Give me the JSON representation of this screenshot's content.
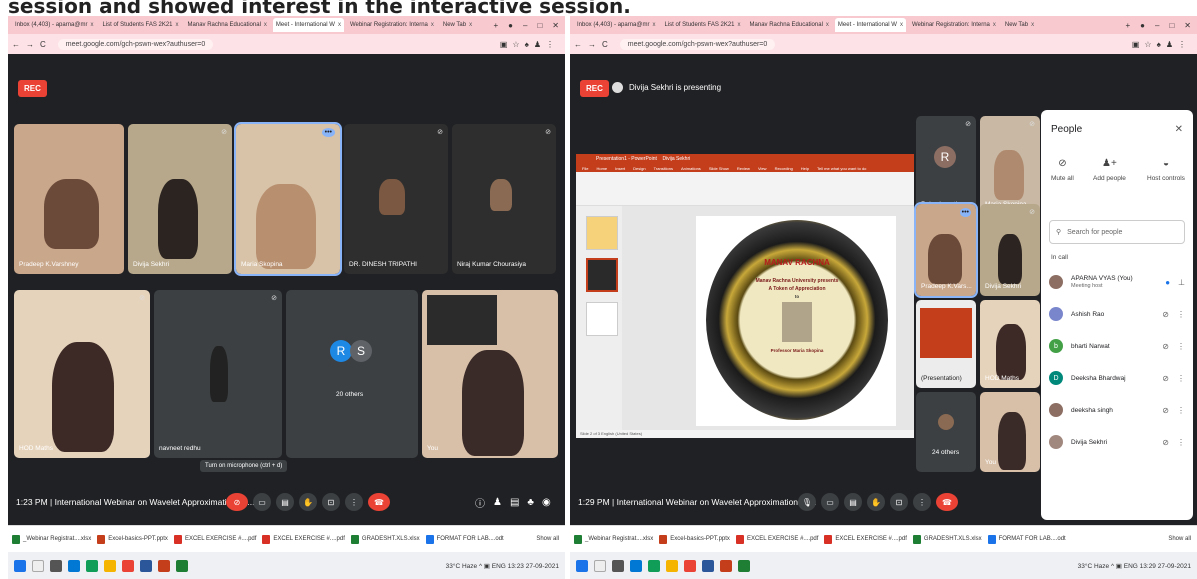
{
  "caption": "session and showed interest in the interactive session.",
  "tabs": [
    {
      "label": "Inbox (4,403) - aparna@mr"
    },
    {
      "label": "List of Students FAS 2K21"
    },
    {
      "label": "Manav Rachna Educational"
    },
    {
      "label": "Meet - International W"
    },
    {
      "label": "Webinar Registration: Interna"
    },
    {
      "label": "New Tab"
    }
  ],
  "address": "meet.google.com/gch-pswn-wex?authuser=0",
  "rec_label": "REC",
  "left": {
    "tiles": [
      {
        "name": "Pradeep K.Varshney"
      },
      {
        "name": "Divija Sekhri"
      },
      {
        "name": "Maria Skopina"
      },
      {
        "name": "DR. DINESH TRIPATHI"
      },
      {
        "name": "Niraj Kumar Chourasiya"
      },
      {
        "name": "HOD Maths"
      },
      {
        "name": "navneet redhu"
      },
      {
        "name": "20 others"
      },
      {
        "name": "You"
      }
    ],
    "others_avatars": [
      "R",
      "S"
    ],
    "tooltip": "Turn on microphone (ctrl + d)",
    "time_title": "1:23 PM  |  International Webinar on Wavelet Approximation in ..."
  },
  "right": {
    "presenting": "Divija Sekhri is presenting",
    "tiles": [
      {
        "name": "Rakesh math"
      },
      {
        "name": "Maria Skopina"
      },
      {
        "name": "Pradeep K.Vars..."
      },
      {
        "name": "Divija Sekhri"
      },
      {
        "name": "(Presentation)"
      },
      {
        "name": "HOD Maths"
      },
      {
        "name": "24 others"
      },
      {
        "name": "You"
      }
    ],
    "rakesh_initial": "R",
    "time_title": "1:29 PM  |  International Webinar on Wavelet Approximation in ...",
    "slide": {
      "logo": "MANAV RACHNA",
      "line1": "Manav Rachna University presents",
      "line2": "A Token of Appreciation",
      "to": "to",
      "person": "Professor Maria Skopina",
      "pp_app": "Presentation1 - PowerPoint",
      "pp_user": "Divija Sekhri",
      "ribbon": [
        "File",
        "Home",
        "Insert",
        "Design",
        "Transitions",
        "Animations",
        "Slide Show",
        "Review",
        "View",
        "Recording",
        "Help"
      ],
      "tell": "Tell me what you want to do",
      "slide_status": "Slide 2 of 3    English (United States)"
    },
    "people": {
      "title": "People",
      "actions": [
        "Mute all",
        "Add people",
        "Host controls"
      ],
      "search_placeholder": "Search for people",
      "in_call": "In call",
      "rows": [
        {
          "name": "APARNA VYAS (You)",
          "sub": "Meeting host",
          "initial": "",
          "color": "#8d6e63"
        },
        {
          "name": "Ashish Rao",
          "sub": "",
          "initial": "",
          "color": "#7986cb"
        },
        {
          "name": "bharti Narwat",
          "sub": "",
          "initial": "b",
          "color": "#43a047"
        },
        {
          "name": "Deeksha Bhardwaj",
          "sub": "",
          "initial": "D",
          "color": "#00897b"
        },
        {
          "name": "deeksha singh",
          "sub": "",
          "initial": "",
          "color": "#8d6e63"
        },
        {
          "name": "Divija Sekhri",
          "sub": "",
          "initial": "",
          "color": "#a1887f"
        }
      ]
    }
  },
  "downloads": [
    {
      "name": "_Webinar Registrat....xlsx",
      "color": "#1e7e34"
    },
    {
      "name": "Excel-basics-PPT.pptx",
      "color": "#c43e1c"
    },
    {
      "name": "EXCEL EXERCISE #....pdf",
      "color": "#d93025"
    },
    {
      "name": "EXCEL EXERCISE #....pdf",
      "color": "#d93025"
    },
    {
      "name": "GRADESHT.XLS.xlsx",
      "color": "#1e7e34"
    },
    {
      "name": "FORMAT FOR LAB....odt",
      "color": "#1a73e8"
    }
  ],
  "show_all": "Show all",
  "taskbar": {
    "weather": "33°C Haze",
    "lang": "ENG",
    "time": "13:29",
    "date": "27-09-2021",
    "time_left": "13:23"
  }
}
